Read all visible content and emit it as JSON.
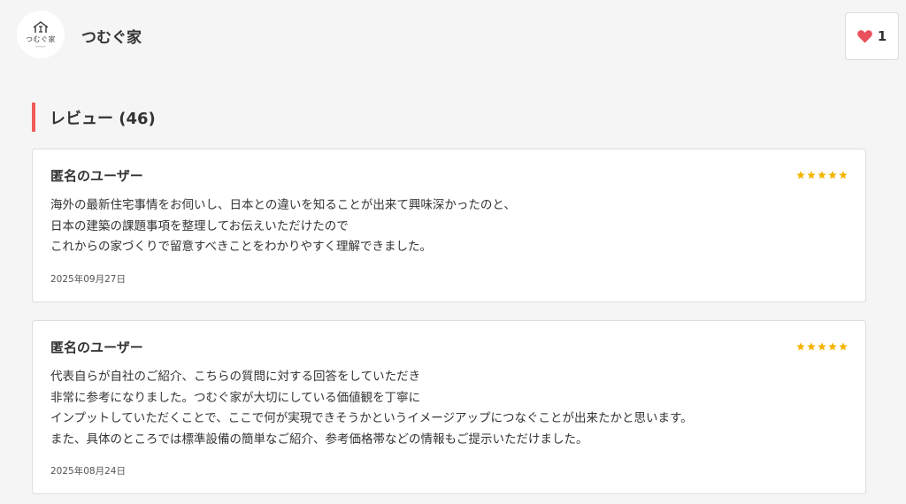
{
  "header": {
    "logo_text": "つむぐ家",
    "shop_name": "つむぐ家",
    "favorite_count": "1"
  },
  "section": {
    "title": "レビュー (46)"
  },
  "reviews": [
    {
      "reviewer": "匿名のユーザー",
      "rating": 5,
      "body": "海外の最新住宅事情をお伺いし、日本との違いを知ることが出来て興味深かったのと、\n日本の建築の課題事項を整理してお伝えいただけたので\nこれからの家づくりで留意すべきことをわかりやすく理解できました。",
      "date": "2025年09月27日"
    },
    {
      "reviewer": "匿名のユーザー",
      "rating": 5,
      "body": "代表自らが自社のご紹介、こちらの質問に対する回答をしていただき\n非常に参考になりました。つむぐ家が大切にしている価値観を丁寧に\nインプットしていただくことで、ここで何が実現できそうかというイメージアップにつなぐことが出来たかと思います。\nまた、具体のところでは標準設備の簡単なご紹介、参考価格帯などの情報もご提示いただけました。",
      "date": "2025年08月24日"
    }
  ],
  "colors": {
    "accent": "#f05a5a",
    "star": "#f5b400",
    "heart": "#e8505b"
  }
}
